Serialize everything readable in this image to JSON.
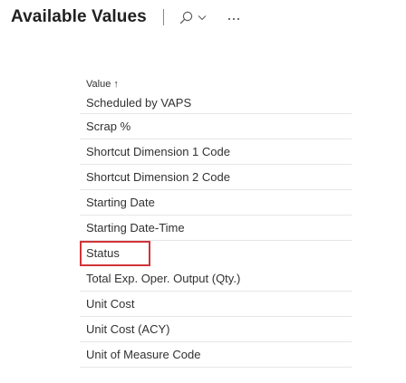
{
  "page": {
    "title": "Available Values"
  },
  "icons": {
    "search": "search-icon",
    "chevron": "chevron-down-icon",
    "more": "more-icon"
  },
  "list": {
    "column_header": "Value",
    "sort_indicator": "↑",
    "items": [
      "Scheduled by VAPS",
      "Scrap %",
      "Shortcut Dimension 1 Code",
      "Shortcut Dimension 2 Code",
      "Starting Date",
      "Starting Date-Time",
      "Status",
      "Total Exp. Oper. Output (Qty.)",
      "Unit Cost",
      "Unit Cost (ACY)",
      "Unit of Measure Code"
    ],
    "selected_index": 6
  },
  "colors": {
    "selection_outline": "#d13438",
    "row_divider": "#e6e6e6",
    "text": "#323130"
  }
}
